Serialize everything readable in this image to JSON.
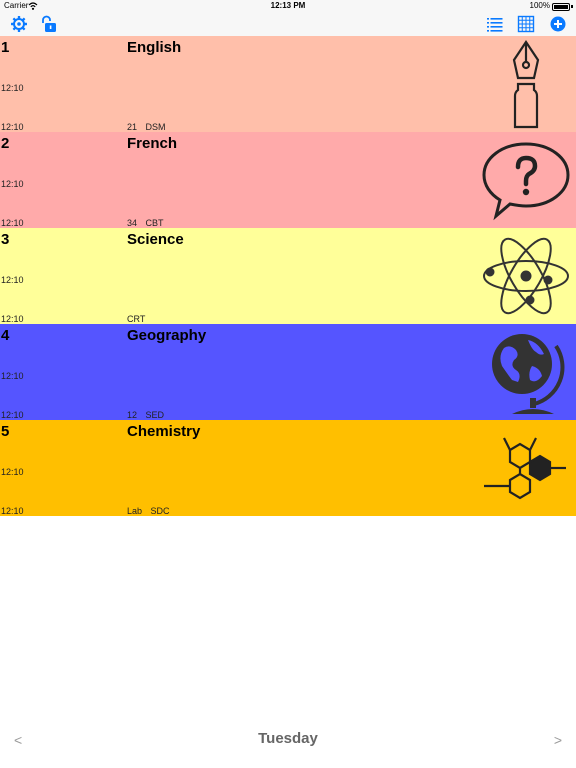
{
  "status_bar": {
    "carrier": "Carrier",
    "time": "12:13 PM",
    "battery": "100%"
  },
  "toolbar": {
    "accent": "#0a7aff",
    "left_icons": [
      "gear-icon",
      "unlock-icon"
    ],
    "right_icons": [
      "list-icon",
      "grid-icon",
      "add-icon"
    ]
  },
  "lessons": [
    {
      "number": "1",
      "subject": "English",
      "start": "12:10",
      "end": "12:10",
      "room": "21 DSM",
      "color": "#ffbfaa",
      "icon": "pen-nib-icon"
    },
    {
      "number": "2",
      "subject": "French",
      "start": "12:10",
      "end": "12:10",
      "room": "34 CBT",
      "color": "#ffaaaa",
      "icon": "question-bubble-icon"
    },
    {
      "number": "3",
      "subject": "Science",
      "start": "12:10",
      "end": "12:10",
      "room": "CRT",
      "color": "#ffff99",
      "icon": "atom-icon"
    },
    {
      "number": "4",
      "subject": "Geography",
      "start": "12:10",
      "end": "12:10",
      "room": "12 SED",
      "color": "#5555ff",
      "icon": "globe-icon"
    },
    {
      "number": "5",
      "subject": "Chemistry",
      "start": "12:10",
      "end": "12:10",
      "room": "Lab SDC",
      "color": "#ffbf00",
      "icon": "molecule-icon"
    }
  ],
  "footer": {
    "prev": "<",
    "day": "Tuesday",
    "next": ">"
  }
}
